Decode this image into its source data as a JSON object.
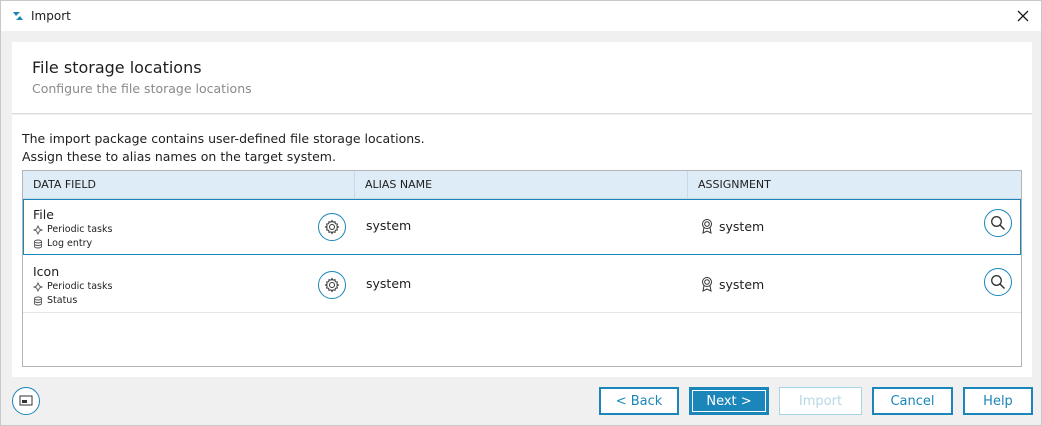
{
  "window": {
    "title": "Import"
  },
  "header": {
    "title": "File storage locations",
    "subtitle": "Configure the file storage locations"
  },
  "content": {
    "description_line1": "The import package contains user-defined file storage locations.",
    "description_line2": "Assign these to alias names on the target system."
  },
  "grid": {
    "columns": [
      "DATA FIELD",
      "ALIAS NAME",
      "ASSIGNMENT"
    ],
    "rows": [
      {
        "name": "File",
        "meta1": "Periodic tasks",
        "meta2": "Log entry",
        "alias": "system",
        "assignment": "system",
        "selected": true
      },
      {
        "name": "Icon",
        "meta1": "Periodic tasks",
        "meta2": "Status",
        "alias": "system",
        "assignment": "system",
        "selected": false
      }
    ]
  },
  "footer": {
    "back_label": "< Back",
    "next_label": "Next >",
    "import_label": "Import",
    "cancel_label": "Cancel",
    "help_label": "Help"
  },
  "colors": {
    "accent": "#1b86b9",
    "header_bg": "#ddecf6",
    "disabled": "#a9d3e6"
  },
  "icons": {
    "app": "app-logo-icon",
    "close": "close-icon",
    "settings": "gear-icon",
    "task": "periodic-task-icon",
    "database": "database-icon",
    "assignment": "award-icon",
    "search": "search-icon",
    "window": "window-icon"
  }
}
